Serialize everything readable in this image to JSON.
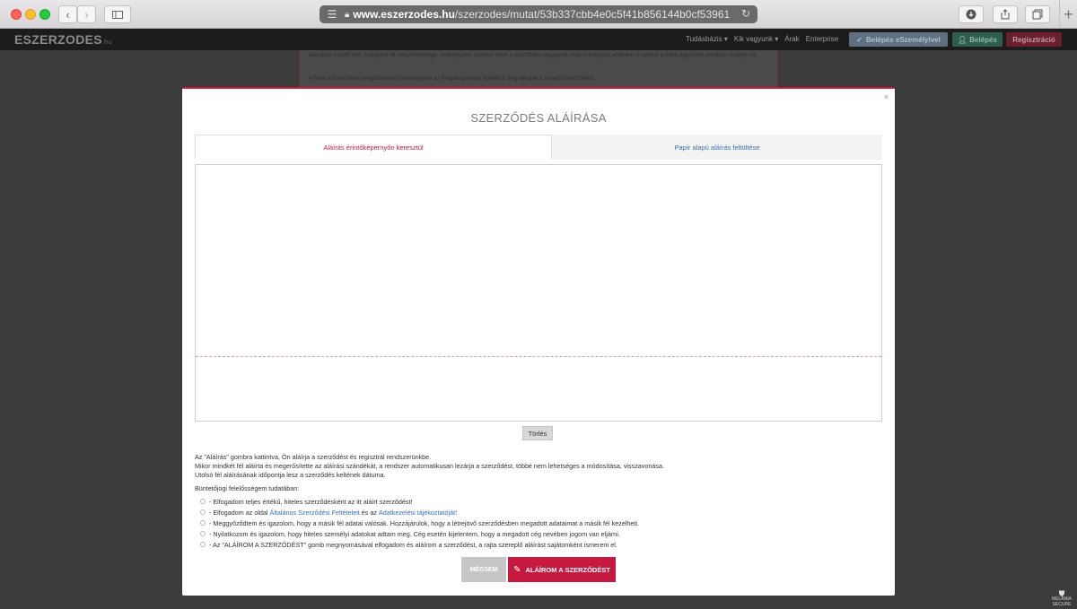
{
  "browser": {
    "url_host": "www.eszerzodes.hu",
    "url_path": "/szerzodes/mutat/53b337cbb4e0c5f41b856144b0cf53961"
  },
  "site": {
    "logo": "ESZERZODES",
    "logo_suffix": ".hu",
    "nav": [
      "Tudásbázis ▾",
      "Kik vagyunk ▾",
      "Árak",
      "Enterprise"
    ],
    "btn_personal": "Belépés eSzemélyivel",
    "btn_login": "Belépés",
    "btn_register": "Regisztráció",
    "bg_text_1": "aláírásuk kezdő lépt. Szegezni ölt telepíthetősége. Amennyiben ezekkel felek a szerződés tárgyának más személyes adatokat is azokat a felek egy külön pontban sorolják fel.",
    "bg_text_2": "A felek a Szerződés megszűnését (amennyiben az megállapítható) követő 8 évig tárolják a létrejött szerződést."
  },
  "modal": {
    "title": "SZERZŐDÉS ALÁÍRÁSA",
    "close": "×",
    "tab_touch": "Aláírás érintőképernyőn keresztül",
    "tab_paper": "Papír alapú aláírás feltöltése",
    "clear_label": "Törlés",
    "info_lines": [
      "Az \"Aláírás\" gombra kattintva, Ön aláírja a szerződést és regisztrál rendszerünkbe.",
      "Mikor mindkét fél aláírta és megerősítette az aláírási szándékát, a rendszer automatikusan lezárja a szerződést, többé nem lehetséges a módosítása, visszavonása.",
      "Utolsó fél aláírásának időpontja lesz a szerződés keltének dátuma."
    ],
    "responsibility_title": "Büntetőjogi felelősségem tudatában:",
    "check_1": "- Elfogadom teljes értékű, hiteles szerződésként az itt aláírt szerződést!",
    "check_2_pre": "- Elfogadom az oldal ",
    "check_2_link1": "Általános Szerződési Feltételeit",
    "check_2_mid": " és az ",
    "check_2_link2": "Adatkezelési tájékoztatóját!",
    "check_3": "- Meggyőződtem és igazolom, hogy a másik fél adatai valósak. Hozzájárulok, hogy a létrejövő szerződésben megadott adataimat a másik fél kezelheti.",
    "check_4": "- Nyilatkozom és igazolom, hogy hiteles személyi adatokat adtam meg. Cég esetén kijelentem, hogy a megadott cég nevében jogom van eljárni.",
    "check_5": "- Az \"ALÁÍROM A SZERZŐDÉST\" gomb megnyomásával elfogadom és aláírom a szerződést, a rajta szereplő aláírást sajátomként ismerem el.",
    "cancel_label": "MÉGSEM",
    "sign_label": "ALÁÍROM A SZERZŐDÉST"
  },
  "corner_logo": "MELÁNIA\nSECURE",
  "colors": {
    "accent": "#c6193f",
    "link": "#3a6fb0"
  }
}
